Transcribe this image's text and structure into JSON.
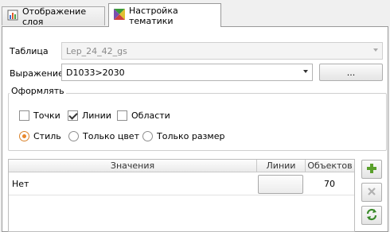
{
  "tabs": [
    {
      "label": "Отображение слоя",
      "active": false
    },
    {
      "label": "Настройка тематики",
      "active": true
    }
  ],
  "form": {
    "table_label": "Таблица",
    "table_value": "Lep_24_42_gs",
    "expression_label": "Выражение",
    "expression_value": "D1033>2030",
    "ellipsis_button": "..."
  },
  "style_group": {
    "title": "Оформлять",
    "checkboxes": [
      {
        "label": "Точки",
        "checked": false
      },
      {
        "label": "Линии",
        "checked": true
      },
      {
        "label": "Области",
        "checked": false
      }
    ],
    "radios": [
      {
        "label": "Стиль",
        "selected": true
      },
      {
        "label": "Только цвет",
        "selected": false
      },
      {
        "label": "Только размер",
        "selected": false
      }
    ]
  },
  "table": {
    "headers": [
      "Значения",
      "Линии",
      "Объектов"
    ],
    "rows": [
      {
        "value": "Нет",
        "count": "70"
      }
    ]
  },
  "side_buttons": [
    "plus-icon",
    "delete-icon",
    "refresh-icon"
  ],
  "colors": {
    "accent": "#e8872c",
    "add": "#5aa02c",
    "refresh": "#3a8a2a"
  }
}
